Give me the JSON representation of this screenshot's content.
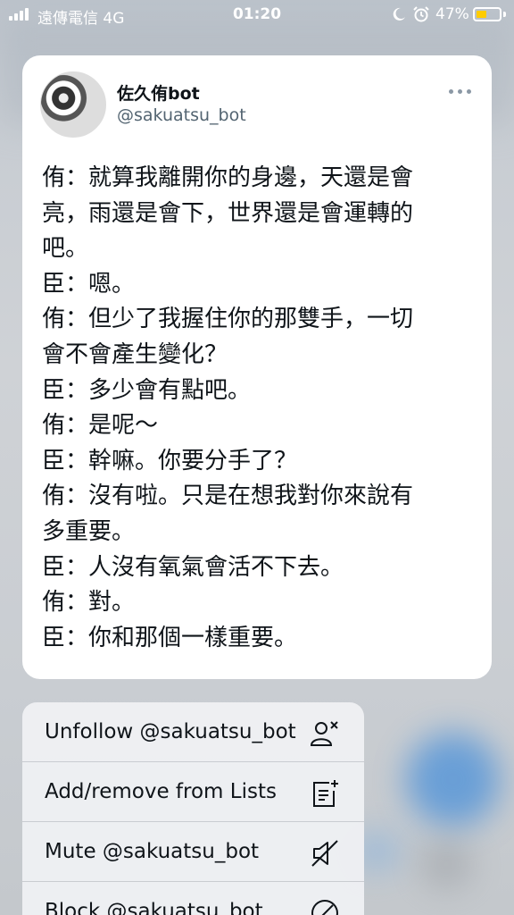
{
  "status_bar": {
    "carrier": "遠傳電信  4G",
    "time": "01:20",
    "battery_percent": "47%",
    "battery_level": 0.47,
    "icons": [
      "signal-icon",
      "moon-icon",
      "alarm-icon",
      "battery-icon"
    ]
  },
  "tweet": {
    "display_name": "佐久侑bot",
    "handle": "@sakuatsu_bot",
    "lines": [
      "侑：就算我離開你的身邊，天還是會",
      "亮，雨還是會下，世界還是會運轉的",
      "吧。",
      "臣：嗯。",
      "侑：但少了我握住你的那雙手，一切",
      "會不會產生變化？",
      "臣：多少會有點吧。",
      "侑：是呢～",
      "臣：幹嘛。你要分手了？",
      "侑：沒有啦。只是在想我對你來說有",
      "多重要。",
      "臣：人沒有氧氣會活不下去。",
      "侑：對。",
      "臣：你和那個一樣重要。"
    ]
  },
  "menu": {
    "items": [
      {
        "label": "Unfollow @sakuatsu_bot",
        "icon": "unfollow-user-icon"
      },
      {
        "label": "Add/remove from Lists",
        "icon": "list-add-icon"
      },
      {
        "label": "Mute @sakuatsu_bot",
        "icon": "mute-speaker-icon"
      },
      {
        "label": "Block @sakuatsu_bot",
        "icon": "block-icon"
      }
    ]
  },
  "colors": {
    "accent_blue": "#4a90d9",
    "battery_yellow": "#ffcc00",
    "text_primary": "#0f1419",
    "text_secondary": "#536471"
  }
}
